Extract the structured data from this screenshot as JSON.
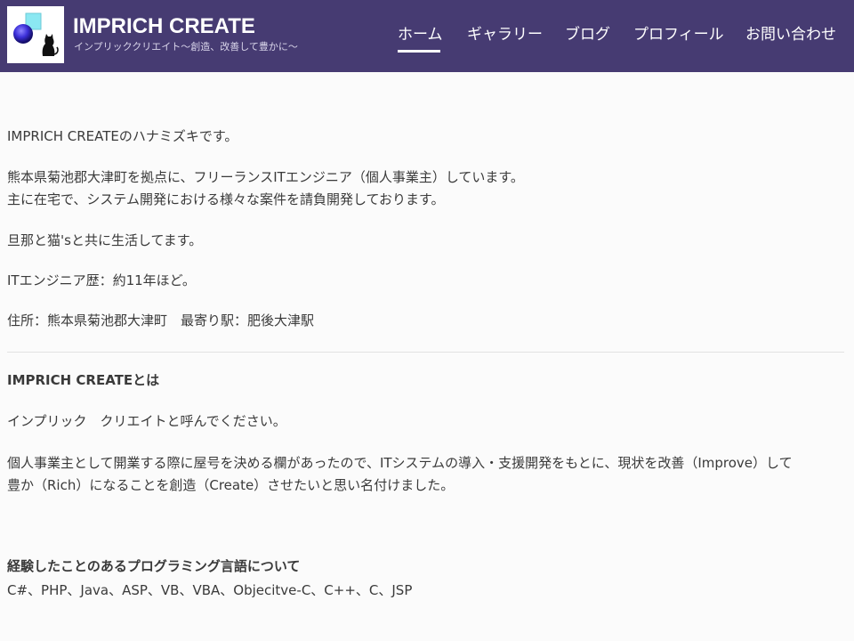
{
  "site": {
    "title": "IMPRICH CREATE",
    "tagline": "インプリッククリエイト〜創造、改善して豊かに〜"
  },
  "nav": {
    "items": [
      {
        "label": "ホーム",
        "active": true
      },
      {
        "label": "ギャラリー",
        "active": false
      },
      {
        "label": "ブログ",
        "active": false
      },
      {
        "label": "プロフィール",
        "active": false
      },
      {
        "label": "お問い合わせ",
        "active": false
      }
    ]
  },
  "content": {
    "intro": "IMPRICH CREATEのハナミズキです。",
    "work_line1": "熊本県菊池郡大津町を拠点に、フリーランスITエンジニア（個人事業主）しています。",
    "work_line2": "主に在宅で、システム開発における様々な案件を請負開発しております。",
    "family": "旦那と猫'sと共に生活してます。",
    "experience": "ITエンジニア歴：約11年ほど。",
    "address": "住所：熊本県菊池郡大津町　最寄り駅：肥後大津駅",
    "about_heading": "IMPRICH CREATEとは",
    "about_reading": "インプリック　クリエイトと呼んでください。",
    "about_line1": "個人事業主として開業する際に屋号を決める欄があったので、ITシステムの導入・支援開発をもとに、現状を改善（Improve）して",
    "about_line2": "豊か（Rich）になることを創造（Create）させたいと思い名付けました。",
    "languages_heading": "経験したことのあるプログラミング言語について",
    "languages": "C#、PHP、Java、ASP、VB、VBA、Objecitve-C、C++、C、JSP"
  },
  "colors": {
    "header_bg": "#463b72",
    "page_bg": "#fbfbfb",
    "text": "#3a3a3a"
  }
}
